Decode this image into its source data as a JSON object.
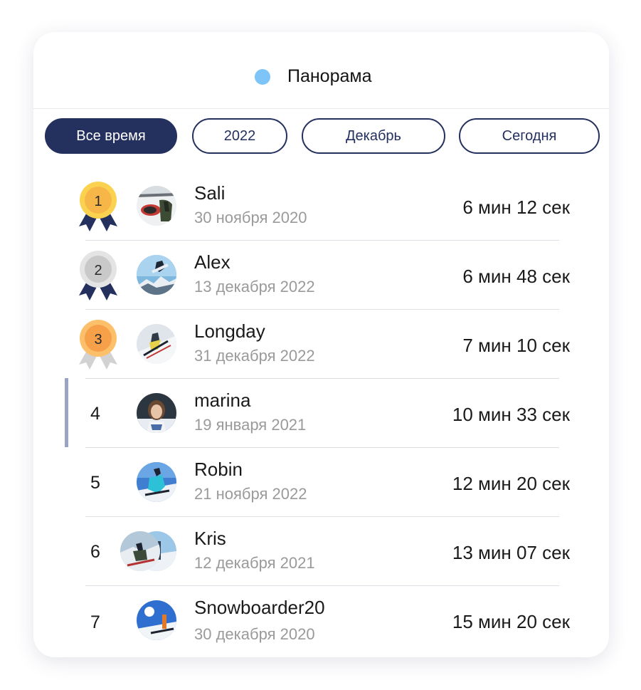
{
  "track": {
    "name": "Панорама",
    "dot_color": "#7dc4f9"
  },
  "filters": [
    {
      "label": "Все время",
      "active": true
    },
    {
      "label": "2022",
      "active": false
    },
    {
      "label": "Декабрь",
      "active": false
    },
    {
      "label": "Сегодня",
      "active": false
    }
  ],
  "colors": {
    "accent": "#24305e",
    "gold": "#f6bd4a",
    "silver": "#d4d4d4",
    "bronze": "#f6a24a",
    "highlight": "#99a4c3"
  },
  "leaderboard": [
    {
      "rank": "1",
      "medal": "gold",
      "name": "Sali",
      "date": "30 ноября 2020",
      "time": "6 мин 12 сек"
    },
    {
      "rank": "2",
      "medal": "silver",
      "name": "Alex",
      "date": "13 декабря 2022",
      "time": "6 мин 48 сек"
    },
    {
      "rank": "3",
      "medal": "bronze",
      "name": "Longday",
      "date": "31 декабря 2022",
      "time": "7 мин 10 сек"
    },
    {
      "rank": "4",
      "medal": "",
      "name": "marina",
      "date": "19 января 2021",
      "time": "10 мин 33 сек",
      "highlighted": true
    },
    {
      "rank": "5",
      "medal": "",
      "name": "Robin",
      "date": "21 ноября 2022",
      "time": "12 мин 20 сек"
    },
    {
      "rank": "6",
      "medal": "",
      "name": "Kris",
      "date": "12 декабря 2021",
      "time": "13 мин 07 сек"
    },
    {
      "rank": "7",
      "medal": "",
      "name": "Snowboarder20",
      "date": "30 декабря 2020",
      "time": "15 мин 20 сек"
    }
  ]
}
